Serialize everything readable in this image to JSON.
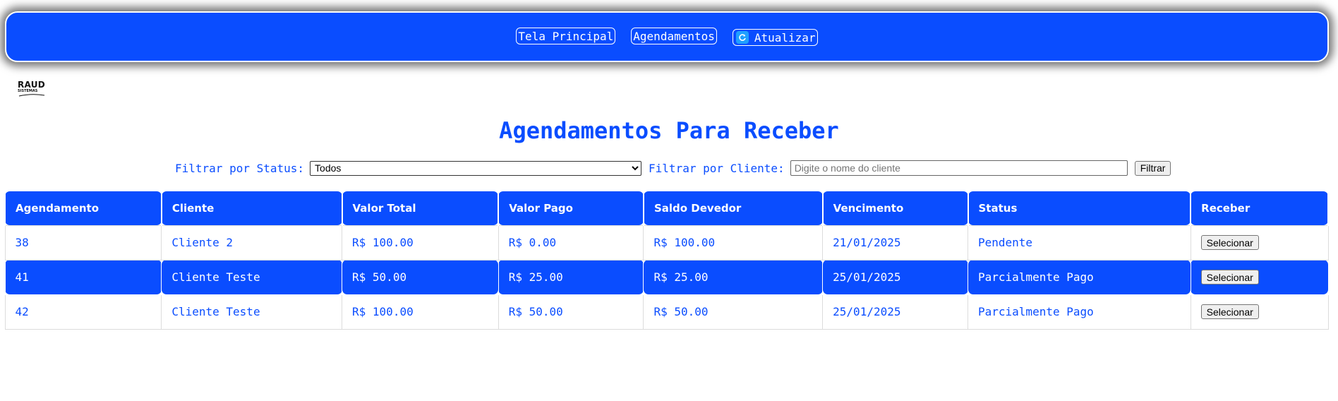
{
  "nav": {
    "home_label": "Tela Principal",
    "appointments_label": "Agendamentos",
    "refresh_label": "Atualizar"
  },
  "logo": {
    "line1": "RAUD",
    "line2": "SISTEMAS"
  },
  "page": {
    "title": "Agendamentos Para Receber"
  },
  "filters": {
    "status_label": "Filtrar por Status:",
    "status_selected": "Todos",
    "client_label": "Filtrar por Cliente:",
    "client_placeholder": "Digite o nome do cliente",
    "client_value": "",
    "filter_button": "Filtrar"
  },
  "table": {
    "columns": [
      "Agendamento",
      "Cliente",
      "Valor Total",
      "Valor Pago",
      "Saldo Devedor",
      "Vencimento",
      "Status",
      "Receber"
    ],
    "rows": [
      {
        "id": "38",
        "cliente": "Cliente 2",
        "valor_total": "R$ 100.00",
        "valor_pago": "R$ 0.00",
        "saldo": "R$ 100.00",
        "vencimento": "21/01/2025",
        "status": "Pendente",
        "action": "Selecionar"
      },
      {
        "id": "41",
        "cliente": "Cliente Teste",
        "valor_total": "R$ 50.00",
        "valor_pago": "R$ 25.00",
        "saldo": "R$ 25.00",
        "vencimento": "25/01/2025",
        "status": "Parcialmente Pago",
        "action": "Selecionar"
      },
      {
        "id": "42",
        "cliente": "Cliente Teste",
        "valor_total": "R$ 100.00",
        "valor_pago": "R$ 50.00",
        "saldo": "R$ 50.00",
        "vencimento": "25/01/2025",
        "status": "Parcialmente Pago",
        "action": "Selecionar"
      }
    ]
  },
  "colors": {
    "accent": "#0a4dff",
    "refresh_icon": "#1fa0ff"
  },
  "icons": {
    "refresh": "refresh-icon"
  }
}
